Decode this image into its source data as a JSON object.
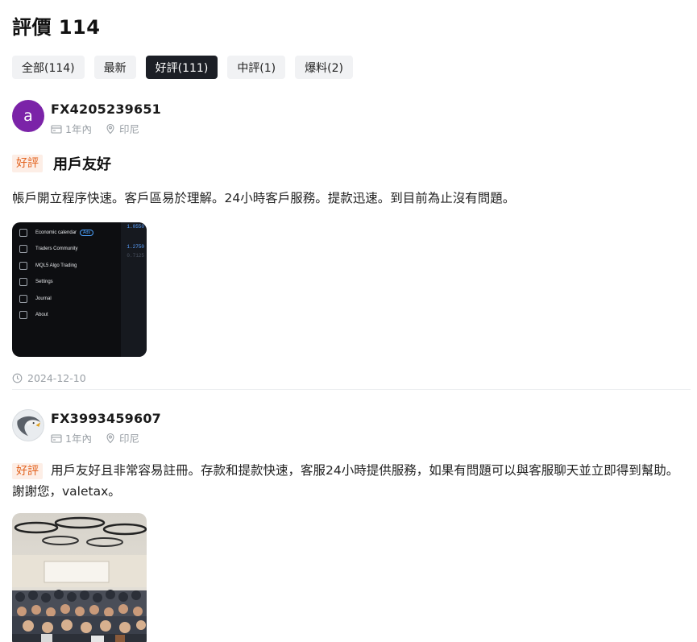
{
  "header": {
    "title": "評價 114"
  },
  "tabs": [
    {
      "label": "全部(114)",
      "active": false
    },
    {
      "label": "最新",
      "active": false
    },
    {
      "label": "好評(111)",
      "active": true
    },
    {
      "label": "中評(1)",
      "active": false
    },
    {
      "label": "爆料(2)",
      "active": false
    }
  ],
  "reviews": [
    {
      "avatar_letter": "a",
      "avatar_color": "#7b23a8",
      "username": "FX4205239651",
      "duration": "1年內",
      "location": "印尼",
      "badge": "好評",
      "title": "用戶友好",
      "text": "帳戶開立程序快速。客戶區易於理解。24小時客戶服務。提款迅速。到目前為止沒有問題。",
      "screenshot": {
        "menu": [
          {
            "label": "Economic calendar",
            "tag": "Ads"
          },
          {
            "label": "Traders Community"
          },
          {
            "label": "MQL5 Algo Trading"
          },
          {
            "label": "Settings"
          },
          {
            "label": "Journal"
          },
          {
            "label": "About"
          }
        ],
        "side_values": [
          "1.0550",
          "1.2750",
          "0.7125"
        ]
      },
      "date": "2024-12-10"
    },
    {
      "avatar_icon": "eagle-logo-icon",
      "username": "FX3993459607",
      "duration": "1年內",
      "location": "印尼",
      "badge": "好評",
      "text": "用戶友好且非常容易註冊。存款和提款快速，客服24小時提供服務，如果有問題可以與客服聊天並立即得到幫助。謝謝您，valetax。"
    }
  ],
  "colors": {
    "badge_bg": "#fdeee6",
    "badge_text": "#e2631f",
    "active_tab": "#1c1f26",
    "tab_bg": "#f1f2f4",
    "meta_text": "#9aa0a6"
  }
}
